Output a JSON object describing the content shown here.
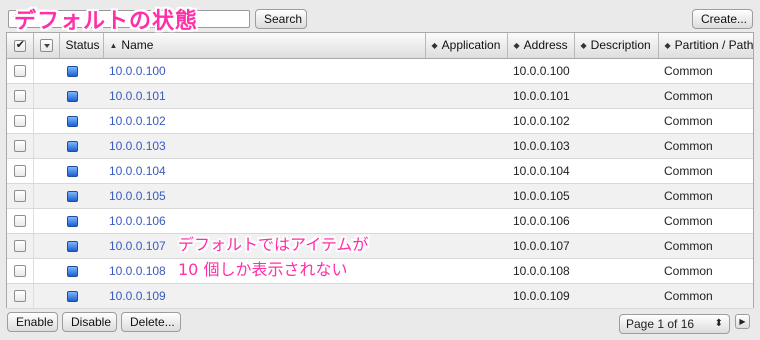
{
  "annotations": {
    "title": "デフォルトの状態",
    "note_line1": "デフォルトではアイテムが",
    "note_line2": "10 個しか表示されない"
  },
  "toolbar": {
    "search_value": "*",
    "search_button": "Search",
    "create_button": "Create..."
  },
  "table": {
    "columns": {
      "status": "Status",
      "name": "Name",
      "application": "Application",
      "address": "Address",
      "description": "Description",
      "partition": "Partition / Path"
    },
    "rows": [
      {
        "name": "10.0.0.100",
        "address": "10.0.0.100",
        "partition": "Common"
      },
      {
        "name": "10.0.0.101",
        "address": "10.0.0.101",
        "partition": "Common"
      },
      {
        "name": "10.0.0.102",
        "address": "10.0.0.102",
        "partition": "Common"
      },
      {
        "name": "10.0.0.103",
        "address": "10.0.0.103",
        "partition": "Common"
      },
      {
        "name": "10.0.0.104",
        "address": "10.0.0.104",
        "partition": "Common"
      },
      {
        "name": "10.0.0.105",
        "address": "10.0.0.105",
        "partition": "Common"
      },
      {
        "name": "10.0.0.106",
        "address": "10.0.0.106",
        "partition": "Common"
      },
      {
        "name": "10.0.0.107",
        "address": "10.0.0.107",
        "partition": "Common"
      },
      {
        "name": "10.0.0.108",
        "address": "10.0.0.108",
        "partition": "Common"
      },
      {
        "name": "10.0.0.109",
        "address": "10.0.0.109",
        "partition": "Common"
      }
    ]
  },
  "footer": {
    "enable_button": "Enable",
    "disable_button": "Disable",
    "delete_button": "Delete...",
    "page_select": "Page 1 of 16"
  },
  "colors": {
    "annotation": "#ff2fa8",
    "link": "#3a5bbf",
    "status_icon": "#2f73e0"
  },
  "icons": {
    "status": "blue-square-status-icon",
    "sort": "sort-ascending-triangle-icon",
    "next": "next-page-triangle-icon"
  }
}
